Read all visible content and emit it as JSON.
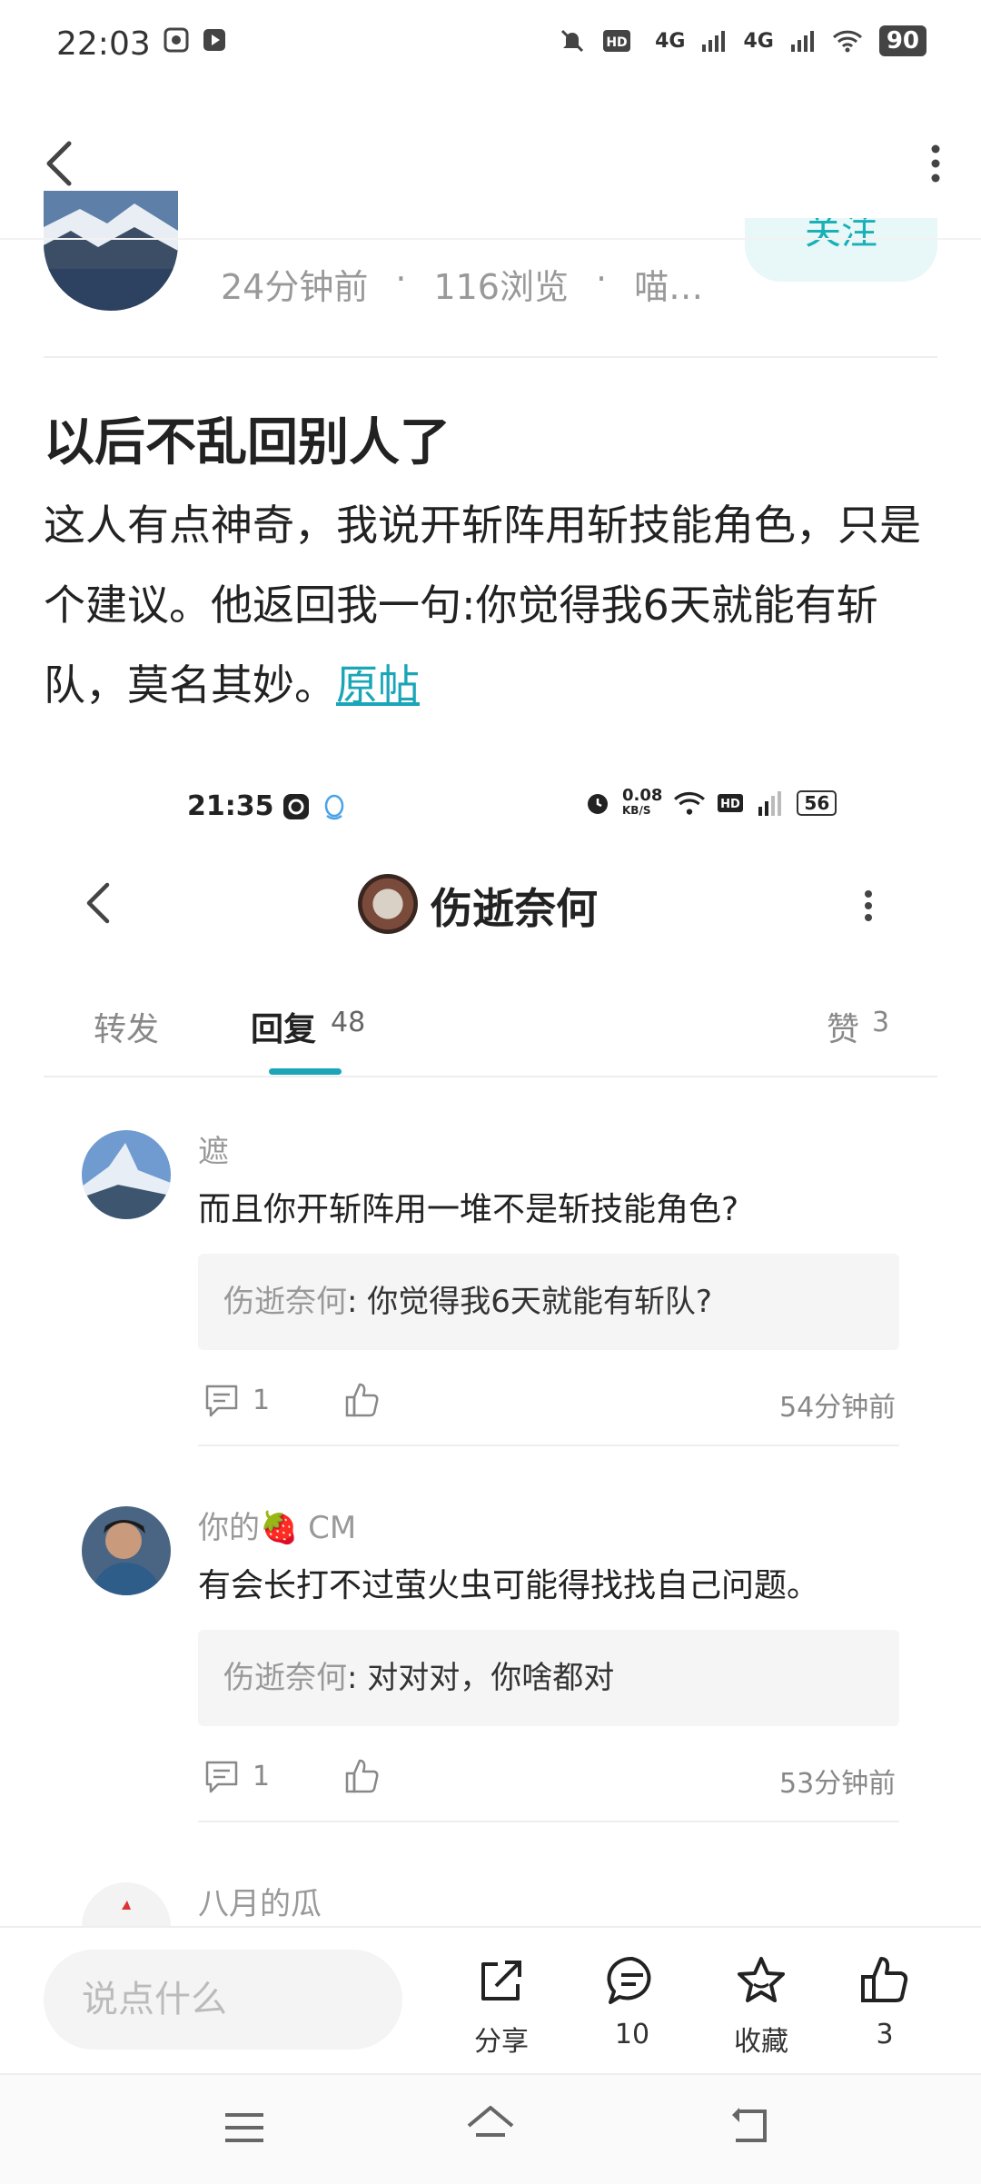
{
  "status_bar": {
    "time": "22:03",
    "network": [
      "4G",
      "4G"
    ],
    "battery": "90"
  },
  "post": {
    "meta": [
      "24分钟前",
      "·",
      "116浏览",
      "·",
      "喵…"
    ],
    "follow_label": "关注",
    "title": "以后不乱回别人了",
    "body": "这人有点神奇，我说开斩阵用斩技能角色，只是个建议。他返回我一句:你觉得我6天就能有斩队，莫名其妙。",
    "link_text": "原帖"
  },
  "embedded": {
    "status_time": "21:35",
    "speed": "0.08",
    "speed_unit": "KB/S",
    "battery": "56",
    "title": "伤逝奈何",
    "tabs": {
      "forward": "转发",
      "reply": "回复",
      "reply_count": "48",
      "like": "赞",
      "like_count": "3"
    },
    "comments": [
      {
        "name": "遮",
        "text": "而且你开斩阵用一堆不是斩技能角色?",
        "quote_name": "伤逝奈何",
        "quote_text": ": 你觉得我6天就能有斩队?",
        "reply_count": "1",
        "time": "54分钟前"
      },
      {
        "name": "你的🍓 CM",
        "text": "有会长打不过萤火虫可能得找找自己问题。",
        "quote_name": "伤逝奈何",
        "quote_text": ": 对对对，你啥都对",
        "reply_count": "1",
        "time": "53分钟前"
      },
      {
        "name": "八月的瓜"
      }
    ]
  },
  "bottom_bar": {
    "input_placeholder": "说点什么",
    "share_label": "分享",
    "comment_count": "10",
    "favorite_label": "收藏",
    "like_count": "3"
  },
  "colors": {
    "accent": "#1aa6b7",
    "follow_bg": "#e8f7f7"
  }
}
